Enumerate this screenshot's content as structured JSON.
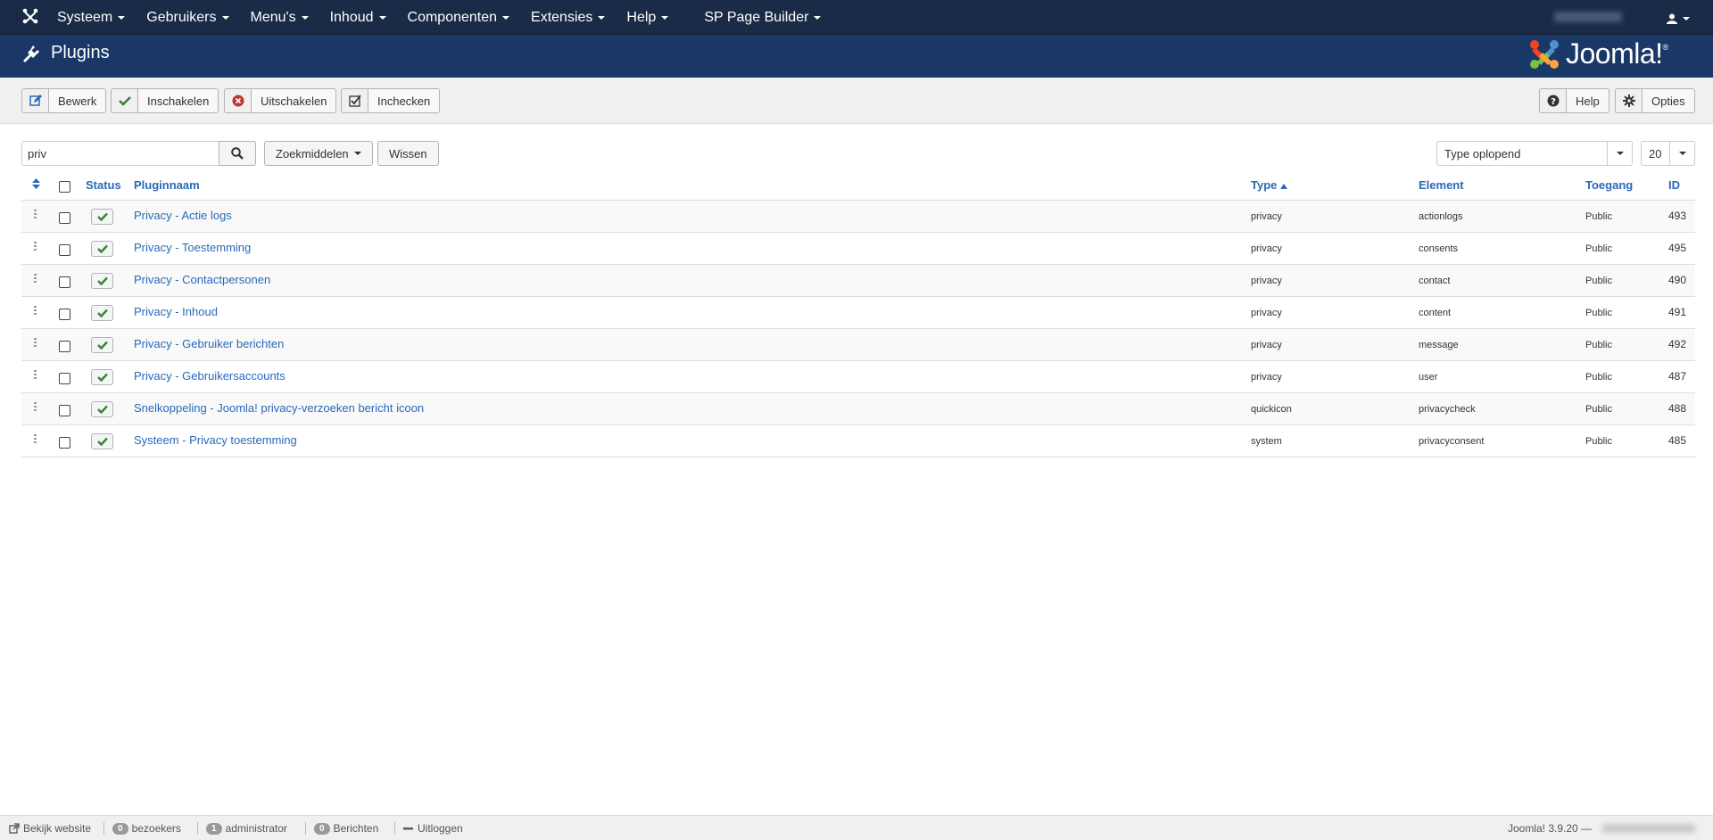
{
  "navbar": {
    "menu": [
      "Systeem",
      "Gebruikers",
      "Menu's",
      "Inhoud",
      "Componenten",
      "Extensies",
      "Help",
      "SP Page Builder"
    ]
  },
  "header": {
    "title": "Plugins",
    "brand": "Joomla!"
  },
  "toolbar": {
    "edit": "Bewerk",
    "enable": "Inschakelen",
    "disable": "Uitschakelen",
    "checkin": "Inchecken",
    "help": "Help",
    "options": "Opties"
  },
  "filters": {
    "search_value": "priv",
    "search_tools": "Zoekmiddelen",
    "clear": "Wissen",
    "order": "Type oplopend",
    "limit": "20"
  },
  "table": {
    "headers": {
      "status": "Status",
      "name": "Pluginnaam",
      "type": "Type",
      "element": "Element",
      "access": "Toegang",
      "id": "ID"
    },
    "rows": [
      {
        "name": "Privacy - Actie logs",
        "type": "privacy",
        "element": "actionlogs",
        "access": "Public",
        "id": "493"
      },
      {
        "name": "Privacy - Toestemming",
        "type": "privacy",
        "element": "consents",
        "access": "Public",
        "id": "495"
      },
      {
        "name": "Privacy - Contactpersonen",
        "type": "privacy",
        "element": "contact",
        "access": "Public",
        "id": "490"
      },
      {
        "name": "Privacy - Inhoud",
        "type": "privacy",
        "element": "content",
        "access": "Public",
        "id": "491"
      },
      {
        "name": "Privacy - Gebruiker berichten",
        "type": "privacy",
        "element": "message",
        "access": "Public",
        "id": "492"
      },
      {
        "name": "Privacy - Gebruikersaccounts",
        "type": "privacy",
        "element": "user",
        "access": "Public",
        "id": "487"
      },
      {
        "name": "Snelkoppeling - Joomla! privacy-verzoeken bericht icoon",
        "type": "quickicon",
        "element": "privacycheck",
        "access": "Public",
        "id": "488"
      },
      {
        "name": "Systeem - Privacy toestemming",
        "type": "system",
        "element": "privacyconsent",
        "access": "Public",
        "id": "485"
      }
    ]
  },
  "footer": {
    "view_site": "Bekijk website",
    "visitors_count": "0",
    "visitors_label": "bezoekers",
    "admins_count": "1",
    "admins_label": "administrator",
    "messages_count": "0",
    "messages_label": "Berichten",
    "logout": "Uitloggen",
    "version": "Joomla! 3.9.20 —"
  }
}
